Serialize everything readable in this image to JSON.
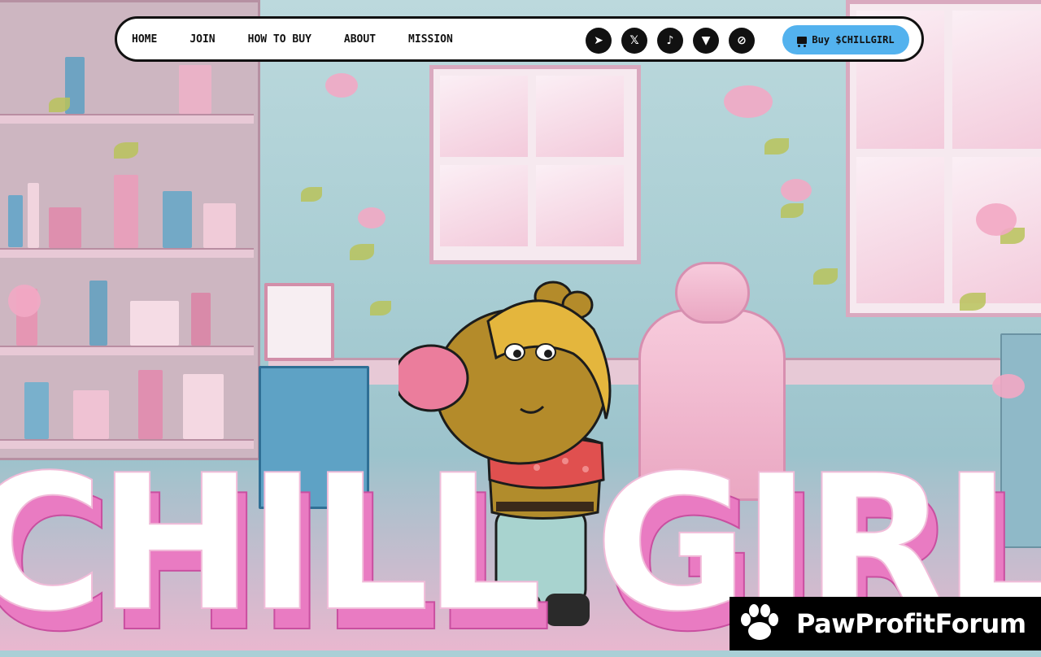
{
  "nav": {
    "links": [
      {
        "label": "HOME"
      },
      {
        "label": "JOIN"
      },
      {
        "label": "HOW TO BUY"
      },
      {
        "label": "ABOUT"
      },
      {
        "label": "MISSION"
      }
    ],
    "socials": [
      {
        "icon": "telegram-icon",
        "glyph": "➤"
      },
      {
        "icon": "x-icon",
        "glyph": "𝕏"
      },
      {
        "icon": "tiktok-icon",
        "glyph": "♪"
      },
      {
        "icon": "wolf-icon",
        "glyph": "▼"
      },
      {
        "icon": "dexscreener-icon",
        "glyph": "⊘"
      }
    ],
    "buy_label": "Buy $CHILLGIRL"
  },
  "hero": {
    "title": "CHILL GIRL"
  },
  "watermark": {
    "text": "PawProfitForum"
  },
  "colors": {
    "accent_blue": "#53b2ee",
    "title_fill": "#ffffff",
    "title_shadow": "#e97bc2",
    "nav_bg": "#ffffff",
    "badge_bg": "#000000"
  }
}
